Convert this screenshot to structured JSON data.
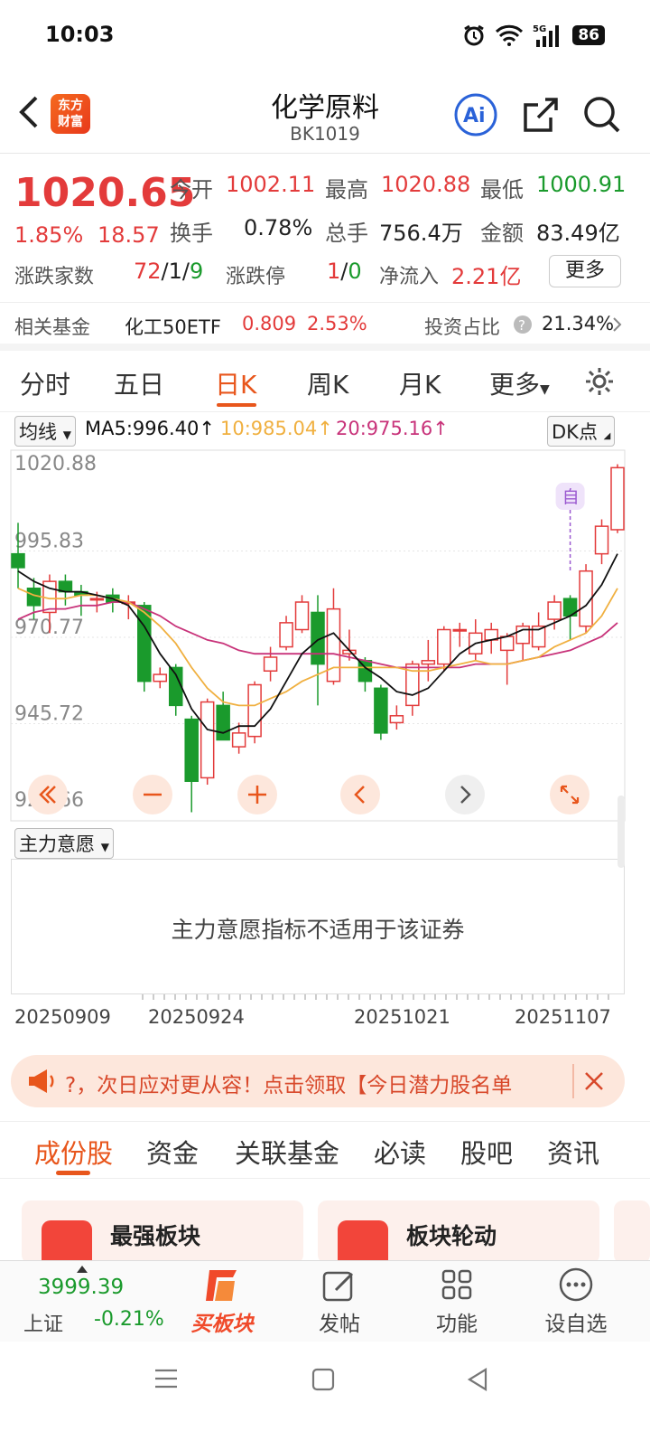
{
  "status_bar": {
    "time": "10:03",
    "battery": "86",
    "signal": "5G"
  },
  "header": {
    "logo_line1": "东方",
    "logo_line2": "财富",
    "title": "化学原料",
    "code": "BK1019"
  },
  "quote": {
    "price": "1020.65",
    "change_pct": "1.85%",
    "change": "18.57",
    "open_label": "今开",
    "open": "1002.11",
    "high_label": "最高",
    "high": "1020.88",
    "low_label": "最低",
    "low": "1000.91",
    "turnover_label": "换手",
    "turnover": "0.78%",
    "volume_label": "总手",
    "volume": "756.4万",
    "amount_label": "金额",
    "amount": "83.49亿",
    "breadth_label": "涨跌家数",
    "up": "72",
    "flat": "1",
    "down": "9",
    "limit_label": "涨跌停",
    "limit_up": "1",
    "limit_down": "0",
    "netflow_label": "净流入",
    "netflow": "2.21亿",
    "more_label": "更多"
  },
  "fund": {
    "label": "相关基金",
    "name": "化工50ETF",
    "price": "0.809",
    "pct": "2.53%",
    "ratio_label": "投资占比",
    "ratio": "21.34%"
  },
  "chart_tabs": {
    "items": [
      "分时",
      "五日",
      "日K",
      "周K",
      "月K"
    ],
    "more": "更多",
    "active": "日K"
  },
  "chart_header": {
    "ma_select": "均线",
    "ma5": "MA5:996.40↑",
    "ma10": "10:985.04↑",
    "ma20": "20:975.16↑",
    "dk": "DK点"
  },
  "sub_indicator": {
    "select": "主力意愿",
    "message": "主力意愿指标不适用于该证券"
  },
  "marker": "自",
  "chart_data": {
    "type": "candlestick",
    "y_ticks": [
      "1020.88",
      "995.83",
      "970.77",
      "945.72",
      "920.66"
    ],
    "ylim": [
      920.66,
      1020.88
    ],
    "x_tick_labels": [
      "20250909",
      "20250924",
      "20251021",
      "20251107"
    ],
    "candles": [
      {
        "o": 995,
        "c": 991,
        "h": 1004,
        "l": 985
      },
      {
        "o": 985,
        "c": 980,
        "h": 988,
        "l": 976
      },
      {
        "o": 978,
        "c": 987,
        "h": 989,
        "l": 972
      },
      {
        "o": 987,
        "c": 984,
        "h": 989,
        "l": 980
      },
      {
        "o": 984,
        "c": 983,
        "h": 986,
        "l": 977
      },
      {
        "o": 982,
        "c": 982,
        "h": 984,
        "l": 978
      },
      {
        "o": 983,
        "c": 981,
        "h": 985,
        "l": 978
      },
      {
        "o": 981,
        "c": 981,
        "h": 983,
        "l": 976
      },
      {
        "o": 980,
        "c": 958,
        "h": 981,
        "l": 955
      },
      {
        "o": 958,
        "c": 960,
        "h": 962,
        "l": 956
      },
      {
        "o": 962,
        "c": 951,
        "h": 963,
        "l": 948
      },
      {
        "o": 947,
        "c": 929,
        "h": 948,
        "l": 920
      },
      {
        "o": 930,
        "c": 952,
        "h": 953,
        "l": 928
      },
      {
        "o": 951,
        "c": 941,
        "h": 955,
        "l": 941
      },
      {
        "o": 939,
        "c": 943,
        "h": 946,
        "l": 937
      },
      {
        "o": 942,
        "c": 957,
        "h": 958,
        "l": 940
      },
      {
        "o": 961,
        "c": 965,
        "h": 968,
        "l": 958
      },
      {
        "o": 968,
        "c": 975,
        "h": 977,
        "l": 967
      },
      {
        "o": 973,
        "c": 981,
        "h": 983,
        "l": 972
      },
      {
        "o": 978,
        "c": 963,
        "h": 983,
        "l": 951
      },
      {
        "o": 958,
        "c": 979,
        "h": 985,
        "l": 957
      },
      {
        "o": 966,
        "c": 967,
        "h": 973,
        "l": 964
      },
      {
        "o": 964,
        "c": 958,
        "h": 965,
        "l": 955
      },
      {
        "o": 956,
        "c": 943,
        "h": 957,
        "l": 941
      },
      {
        "o": 946,
        "c": 948,
        "h": 951,
        "l": 944
      },
      {
        "o": 951,
        "c": 963,
        "h": 964,
        "l": 948
      },
      {
        "o": 963,
        "c": 964,
        "h": 970,
        "l": 958
      },
      {
        "o": 963,
        "c": 973,
        "h": 974,
        "l": 961
      },
      {
        "o": 973,
        "c": 973,
        "h": 975,
        "l": 968
      },
      {
        "o": 966,
        "c": 972,
        "h": 976,
        "l": 964
      },
      {
        "o": 970,
        "c": 973,
        "h": 975,
        "l": 966
      },
      {
        "o": 967,
        "c": 971,
        "h": 972,
        "l": 957
      },
      {
        "o": 969,
        "c": 974,
        "h": 975,
        "l": 964
      },
      {
        "o": 968,
        "c": 974,
        "h": 978,
        "l": 967
      },
      {
        "o": 976,
        "c": 981,
        "h": 983,
        "l": 973
      },
      {
        "o": 982,
        "c": 977,
        "h": 983,
        "l": 970
      },
      {
        "o": 974,
        "c": 990,
        "h": 992,
        "l": 972
      },
      {
        "o": 995,
        "c": 1003,
        "h": 1005,
        "l": 992
      },
      {
        "o": 1002,
        "c": 1020,
        "h": 1021,
        "l": 1001
      }
    ],
    "ma5": [
      990,
      987,
      985,
      984,
      984,
      983,
      982,
      980,
      974,
      966,
      960,
      950,
      944,
      943,
      945,
      945,
      950,
      958,
      966,
      970,
      972,
      967,
      962,
      959,
      955,
      954,
      956,
      961,
      966,
      969,
      970,
      971,
      973,
      973,
      975,
      977,
      980,
      986,
      995
    ],
    "ma10": [
      985,
      983,
      982,
      982,
      983,
      983,
      982,
      981,
      978,
      974,
      969,
      962,
      956,
      952,
      951,
      951,
      953,
      955,
      958,
      960,
      962,
      962,
      962,
      962,
      962,
      961,
      961,
      962,
      963,
      964,
      963,
      963,
      964,
      965,
      968,
      970,
      972,
      977,
      985
    ],
    "ma20": [
      976,
      978,
      979,
      979,
      980,
      980,
      981,
      981,
      979,
      977,
      974,
      972,
      970,
      969,
      967,
      966,
      966,
      966,
      966,
      966,
      966,
      965,
      964,
      963,
      962,
      962,
      962,
      962,
      962,
      963,
      963,
      963,
      964,
      965,
      966,
      967,
      969,
      971,
      975
    ]
  },
  "banner": {
    "text": "?，次日应对更从容！点击领取【今日潜力股名单"
  },
  "bottom_tabs": [
    "成份股",
    "资金",
    "关联基金",
    "必读",
    "股吧",
    "资讯"
  ],
  "cards": [
    {
      "title": "最强板块"
    },
    {
      "title": "板块轮动"
    }
  ],
  "bottom_nav": {
    "index_value": "3999.39",
    "index_name": "上证",
    "index_pct": "-0.21%",
    "buy_label": "买板块",
    "post_label": "发帖",
    "func_label": "功能",
    "watch_label": "设自选"
  },
  "colors": {
    "up": "#e33b3b",
    "down": "#1a9a2c",
    "accent": "#e8561c",
    "ma5": "#111111",
    "ma10": "#f0b040",
    "ma20": "#c8337a"
  }
}
